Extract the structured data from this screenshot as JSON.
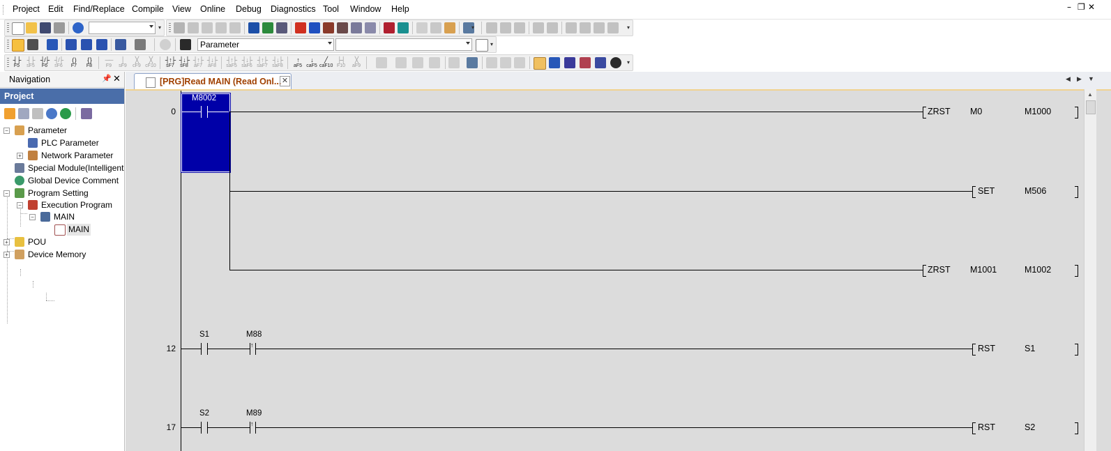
{
  "colors": {
    "accent": "#0000a8",
    "project_header": "#4a6ea9",
    "tab_text": "#a04000",
    "editor_bg": "#dcdcdc"
  },
  "menu": {
    "items": [
      "Project",
      "Edit",
      "Find/Replace",
      "Compile",
      "View",
      "Online",
      "Debug",
      "Diagnostics",
      "Tool",
      "Window",
      "Help"
    ]
  },
  "window_controls": {
    "minimize": "–",
    "restore": "❐",
    "close": "✕"
  },
  "toolbar2": {
    "combo_value": "Parameter"
  },
  "toolbar3": {
    "fkeys": [
      "F5",
      "sF5",
      "F6",
      "sF6",
      "F7",
      "F8",
      "F9",
      "sF9",
      "cF9",
      "cF10",
      "sF7",
      "sF8",
      "aF7",
      "aF8",
      "saF5",
      "saF6",
      "saF7",
      "saF8",
      "aF5",
      "caF5",
      "caF10",
      "F10",
      "aF9"
    ]
  },
  "navigation": {
    "title": "Navigation",
    "pin": "ᚴ",
    "close": "✕",
    "project_label": "Project",
    "tree": [
      {
        "label": "Parameter",
        "depth": 0,
        "expander": "−"
      },
      {
        "label": "PLC Parameter",
        "depth": 1,
        "expander": ""
      },
      {
        "label": "Network Parameter",
        "depth": 1,
        "expander": "+"
      },
      {
        "label": "Special Module(Intelligent",
        "depth": 0,
        "expander": ""
      },
      {
        "label": "Global Device Comment",
        "depth": 0,
        "expander": ""
      },
      {
        "label": "Program Setting",
        "depth": 0,
        "expander": "−"
      },
      {
        "label": "Execution Program",
        "depth": 1,
        "expander": "−"
      },
      {
        "label": "MAIN",
        "depth": 2,
        "expander": "−"
      },
      {
        "label": "MAIN",
        "depth": 3,
        "expander": ""
      },
      {
        "label": "POU",
        "depth": 0,
        "expander": "+"
      },
      {
        "label": "Device Memory",
        "depth": 0,
        "expander": "+"
      }
    ]
  },
  "tab": {
    "label": "[PRG]Read MAIN (Read Onl...",
    "close": "✕",
    "nav_left": "◀",
    "nav_right": "▶",
    "nav_menu": "▼"
  },
  "ladder": {
    "rows": [
      {
        "step": "0",
        "contacts": [
          "M8002"
        ],
        "coils": [
          {
            "inst": "ZRST",
            "ops": [
              "M0",
              "M1000"
            ]
          },
          {
            "inst": "SET",
            "ops": [
              "M506"
            ]
          },
          {
            "inst": "ZRST",
            "ops": [
              "M1001",
              "M1002"
            ]
          }
        ]
      },
      {
        "step": "12",
        "contacts": [
          "S1",
          "M88"
        ],
        "coils": [
          {
            "inst": "RST",
            "ops": [
              "S1"
            ]
          }
        ]
      },
      {
        "step": "17",
        "contacts": [
          "S2",
          "M89"
        ],
        "coils": [
          {
            "inst": "RST",
            "ops": [
              "S2"
            ]
          }
        ]
      }
    ]
  }
}
